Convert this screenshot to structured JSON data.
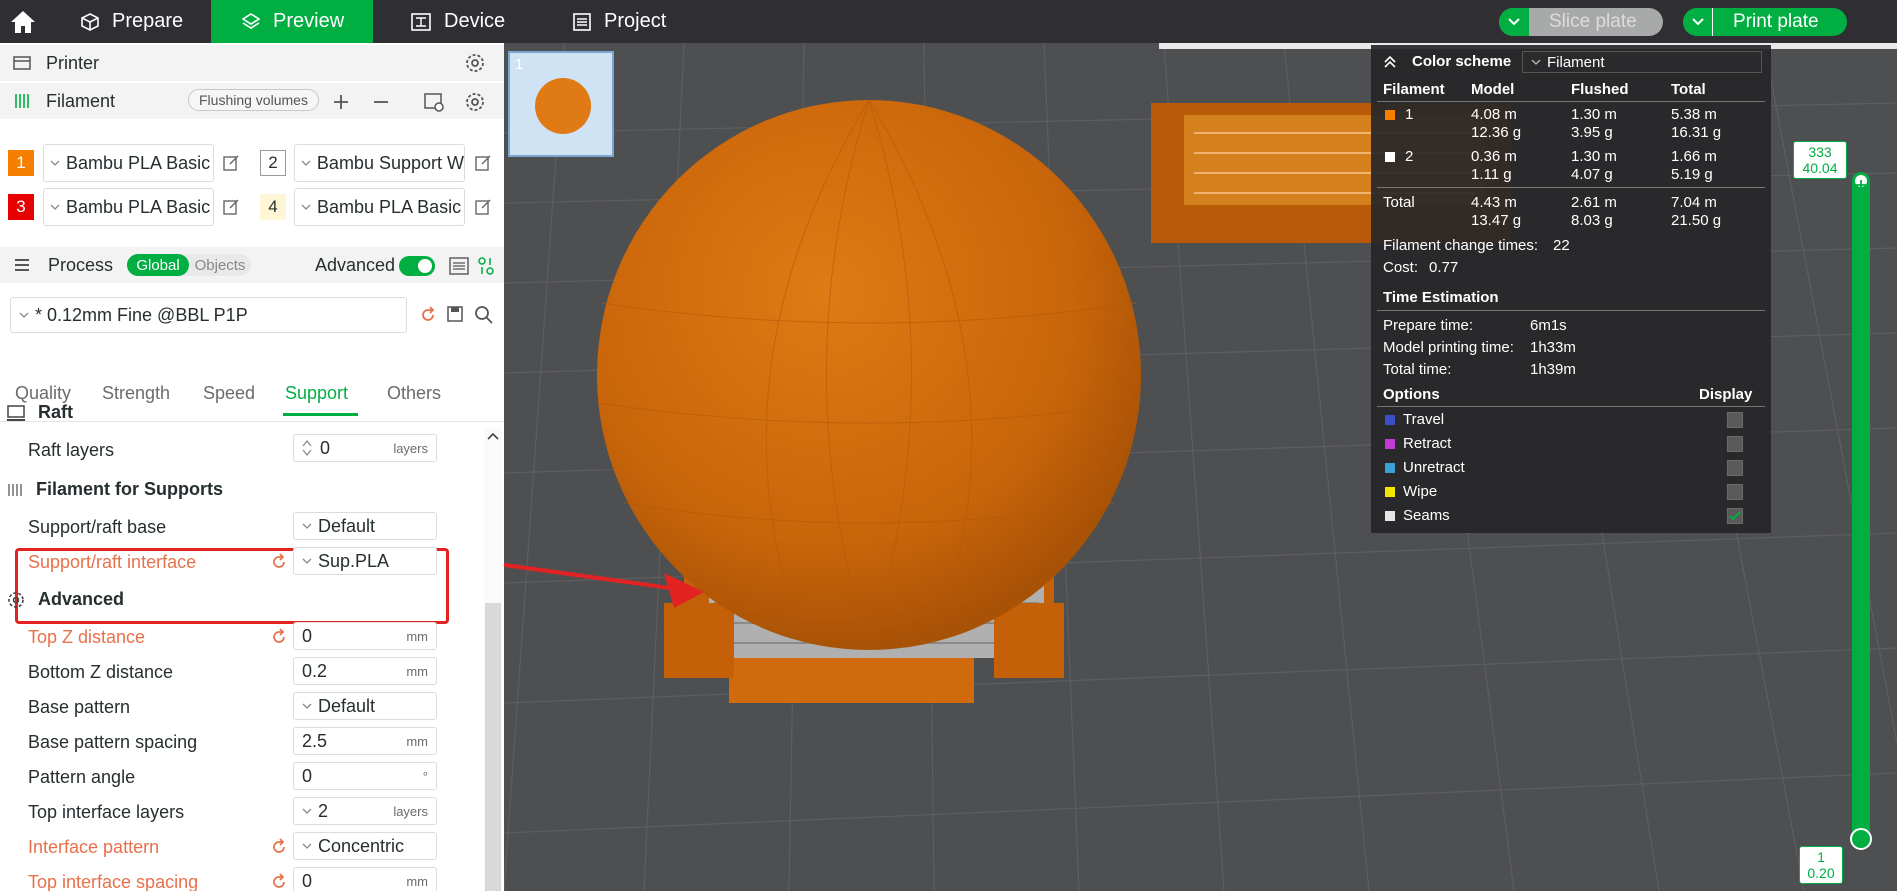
{
  "topbar": {
    "tabs": [
      {
        "label": "Prepare",
        "icon": "cube-icon"
      },
      {
        "label": "Preview",
        "icon": "layers-icon"
      },
      {
        "label": "Device",
        "icon": "device-icon"
      },
      {
        "label": "Project",
        "icon": "project-icon"
      }
    ],
    "active_tab": "Preview",
    "slice_button": "Slice plate",
    "print_button": "Print plate",
    "accent": "#00ae42"
  },
  "printer": {
    "label": "Printer"
  },
  "filament": {
    "label": "Filament",
    "flushing_label": "Flushing volumes",
    "slots": [
      {
        "num": "1",
        "name": "Bambu PLA Basic",
        "color": "#f77f00"
      },
      {
        "num": "2",
        "name": "Bambu Support W",
        "color": "#ffffff"
      },
      {
        "num": "3",
        "name": "Bambu PLA Basic",
        "color": "#e60000"
      },
      {
        "num": "4",
        "name": "Bambu PLA Basic",
        "color": "#fff6d6"
      }
    ]
  },
  "process": {
    "label": "Process",
    "global_label": "Global",
    "objects_label": "Objects",
    "advanced_label": "Advanced",
    "preset": "* 0.12mm Fine @BBL P1P"
  },
  "settings_tabs": [
    "Quality",
    "Strength",
    "Speed",
    "Support",
    "Others"
  ],
  "active_settings_tab": "Support",
  "raft": {
    "title": "Raft",
    "raft_layers_label": "Raft layers",
    "raft_layers_value": "0",
    "raft_layers_unit": "layers"
  },
  "filament_for_supports": {
    "title": "Filament for Supports",
    "base_label": "Support/raft base",
    "base_value": "Default",
    "interface_label": "Support/raft interface",
    "interface_value": "Sup.PLA"
  },
  "advanced": {
    "title": "Advanced",
    "rows": [
      {
        "label": "Top Z distance",
        "value": "0",
        "unit": "mm"
      },
      {
        "label": "Bottom Z distance",
        "value": "0.2",
        "unit": "mm"
      },
      {
        "label": "Base pattern",
        "value": "Default",
        "unit": ""
      },
      {
        "label": "Base pattern spacing",
        "value": "2.5",
        "unit": "mm"
      },
      {
        "label": "Pattern angle",
        "value": "0",
        "unit": "°"
      },
      {
        "label": "Top interface layers",
        "value": "2",
        "unit": "layers"
      },
      {
        "label": "Interface pattern",
        "value": "Concentric",
        "unit": ""
      },
      {
        "label": "Top interface spacing",
        "value": "0",
        "unit": "mm"
      }
    ]
  },
  "plate": {
    "number": "1"
  },
  "legend": {
    "color_scheme_label": "Color scheme",
    "color_scheme_value": "Filament",
    "headers": [
      "Filament",
      "Model",
      "Flushed",
      "Total"
    ],
    "rows": [
      {
        "id": "1",
        "color": "#f77f00",
        "model_m": "4.08 m",
        "model_g": "12.36 g",
        "flushed_m": "1.30 m",
        "flushed_g": "3.95 g",
        "total_m": "5.38 m",
        "total_g": "16.31 g"
      },
      {
        "id": "2",
        "color": "#ffffff",
        "model_m": "0.36 m",
        "model_g": "1.11 g",
        "flushed_m": "1.30 m",
        "flushed_g": "4.07 g",
        "total_m": "1.66 m",
        "total_g": "5.19 g"
      }
    ],
    "total": {
      "label": "Total",
      "model_m": "4.43 m",
      "model_g": "13.47 g",
      "flushed_m": "2.61 m",
      "flushed_g": "8.03 g",
      "total_m": "7.04 m",
      "total_g": "21.50 g"
    },
    "change_times_label": "Filament change times:",
    "change_times_value": "22",
    "cost_label": "Cost:",
    "cost_value": "0.77",
    "time_title": "Time Estimation",
    "prepare_label": "Prepare time:",
    "prepare_value": "6m1s",
    "model_time_label": "Model printing time:",
    "model_time_value": "1h33m",
    "total_time_label": "Total time:",
    "total_time_value": "1h39m",
    "options_label": "Options",
    "display_label": "Display",
    "options": [
      {
        "label": "Travel",
        "color": "#3b4fc4",
        "checked": false
      },
      {
        "label": "Retract",
        "color": "#c23bd6",
        "checked": false
      },
      {
        "label": "Unretract",
        "color": "#3aa0d8",
        "checked": false
      },
      {
        "label": "Wipe",
        "color": "#f2e600",
        "checked": false
      },
      {
        "label": "Seams",
        "color": "#e6e6e6",
        "checked": true
      }
    ]
  },
  "layer_slider": {
    "top_layer": "333",
    "top_height": "40.04",
    "bottom_layer": "1",
    "bottom_height": "0.20"
  }
}
